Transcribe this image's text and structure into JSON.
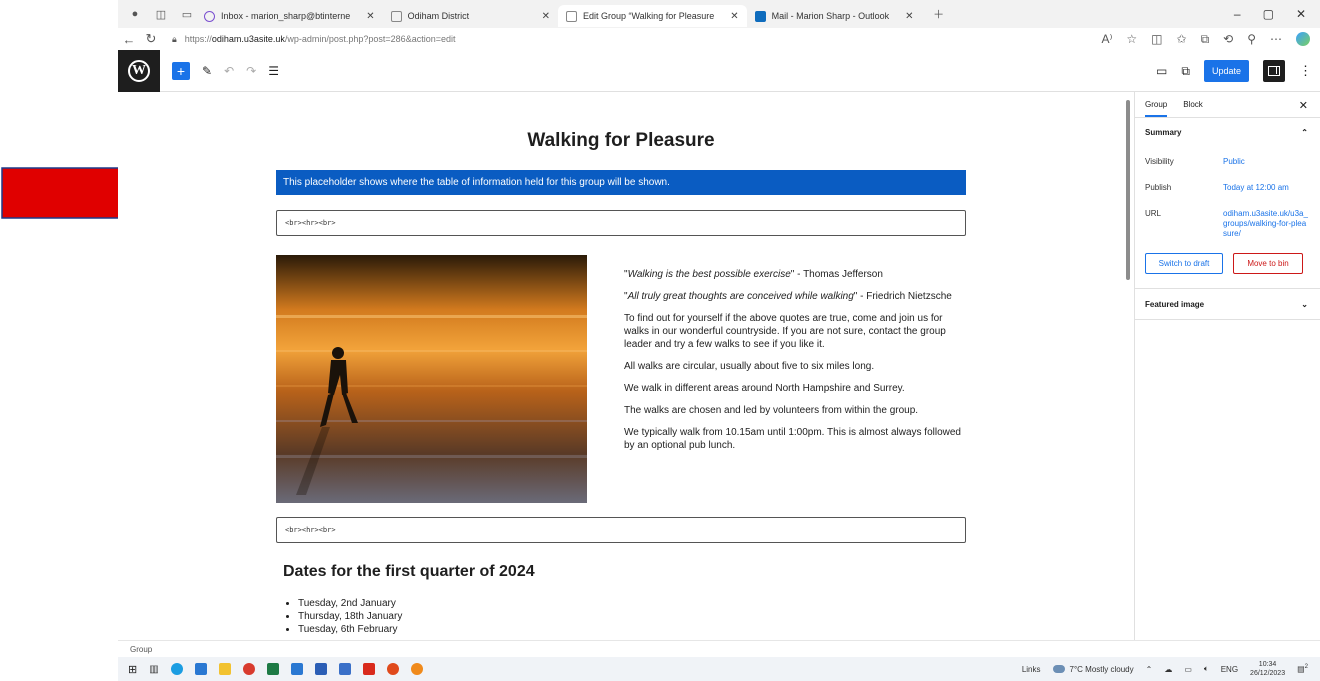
{
  "browser": {
    "tabs": [
      {
        "label": "Inbox - marion_sharp@btinterne",
        "active": false
      },
      {
        "label": "Odiham District",
        "active": false
      },
      {
        "label": "Edit Group “Walking for Pleasure",
        "active": true
      },
      {
        "label": "Mail - Marion Sharp - Outlook",
        "active": false
      }
    ],
    "url_prefix": "https://",
    "url_domain": "odiham.u3asite.uk",
    "url_path": "/wp-admin/post.php?post=286&action=edit"
  },
  "toolbar": {
    "update_label": "Update"
  },
  "page": {
    "title": "Walking for Pleasure",
    "placeholder_text": "This placeholder shows where the table of information held for this group will be shown.",
    "code_block_1": "<br><hr><br>",
    "code_block_2": "<br><hr><br>",
    "quote1_text": "Walking is the best possible exercise",
    "quote1_author": " - Thomas Jefferson",
    "quote2_text": "All truly great thoughts are conceived while walking",
    "quote2_author": " - Friedrich Nietzsche",
    "para1": "To find out for yourself if the above quotes are true, come and join us for walks in our wonderful countryside.  If you are not sure, contact the group leader and try a few walks to see if you like it.",
    "para2": "All walks are circular, usually about five to six miles long.",
    "para3": "We walk in different areas around North Hampshire and Surrey.",
    "para4": "The walks are chosen and led by volunteers from within the group.",
    "para5": "We typically walk from 10.15am until 1:00pm. This is almost always followed by an optional pub lunch.",
    "dates_heading": "Dates for the first quarter of 2024",
    "dates": [
      "Tuesday, 2nd  January",
      "Thursday, 18th January",
      "Tuesday, 6th February"
    ]
  },
  "statusbar": {
    "breadcrumb": "Group"
  },
  "sidebar": {
    "tab_group": "Group",
    "tab_block": "Block",
    "summary_heading": "Summary",
    "visibility_label": "Visibility",
    "visibility_value": "Public",
    "publish_label": "Publish",
    "publish_value": "Today at 12:00 am",
    "url_label": "URL",
    "url_value": "odiham.u3asite.uk/u3a_groups/walking-for-pleasure/",
    "switch_draft": "Switch to draft",
    "move_bin": "Move to bin",
    "featured_image": "Featured image"
  },
  "taskbar": {
    "links": "Links",
    "weather": "7°C  Mostly cloudy",
    "lang": "ENG",
    "time": "10:34",
    "date": "26/12/2023",
    "notif_count": "2"
  },
  "colors": {
    "accent": "#1a73e8",
    "placeholder_bg": "#0a5cc2",
    "danger": "#cc1818",
    "arrow": "#e00000"
  }
}
